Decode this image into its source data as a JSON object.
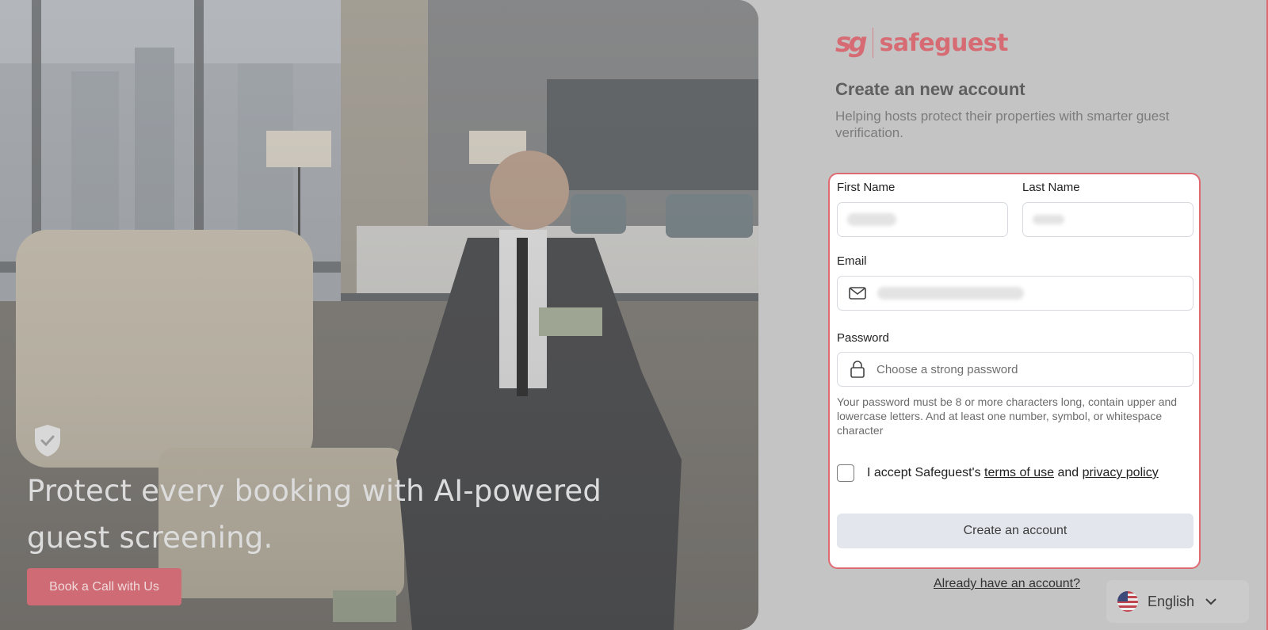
{
  "hero": {
    "headline": "Protect every booking with AI-powered guest screening.",
    "cta_label": "Book a Call with Us"
  },
  "brand": {
    "logo_mark": "sg",
    "logo_text": "safeguest",
    "color": "#d76b73"
  },
  "form": {
    "title": "Create an new account",
    "subtitle": "Helping hosts protect their properties with smarter guest verification.",
    "first_name_label": "First Name",
    "last_name_label": "Last Name",
    "email_label": "Email",
    "password_label": "Password",
    "password_placeholder": "Choose a strong password",
    "password_hint": "Your password must be 8 or more characters long, contain upper and lowercase letters. And at least one number, symbol, or whitespace character",
    "accept_prefix": "I accept Safeguest's ",
    "terms_link": "terms of use",
    "accept_and": " and ",
    "privacy_link": "privacy policy",
    "submit_label": "Create an account",
    "signin_link": "Already have an account?"
  },
  "language": {
    "selected": "English",
    "flag_icon": "us-flag-icon"
  },
  "colors": {
    "accent": "#e06a72",
    "button_bg": "#e3e6ec"
  }
}
